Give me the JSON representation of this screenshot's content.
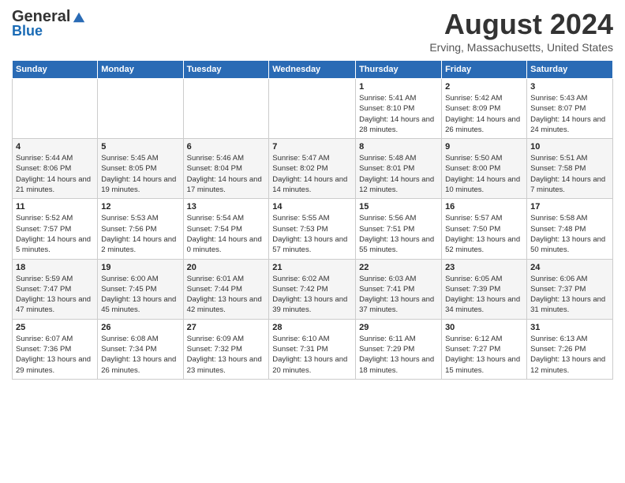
{
  "header": {
    "logo_general": "General",
    "logo_blue": "Blue",
    "month": "August 2024",
    "location": "Erving, Massachusetts, United States"
  },
  "days_of_week": [
    "Sunday",
    "Monday",
    "Tuesday",
    "Wednesday",
    "Thursday",
    "Friday",
    "Saturday"
  ],
  "weeks": [
    [
      {
        "day": "",
        "info": ""
      },
      {
        "day": "",
        "info": ""
      },
      {
        "day": "",
        "info": ""
      },
      {
        "day": "",
        "info": ""
      },
      {
        "day": "1",
        "info": "Sunrise: 5:41 AM\nSunset: 8:10 PM\nDaylight: 14 hours and 28 minutes."
      },
      {
        "day": "2",
        "info": "Sunrise: 5:42 AM\nSunset: 8:09 PM\nDaylight: 14 hours and 26 minutes."
      },
      {
        "day": "3",
        "info": "Sunrise: 5:43 AM\nSunset: 8:07 PM\nDaylight: 14 hours and 24 minutes."
      }
    ],
    [
      {
        "day": "4",
        "info": "Sunrise: 5:44 AM\nSunset: 8:06 PM\nDaylight: 14 hours and 21 minutes."
      },
      {
        "day": "5",
        "info": "Sunrise: 5:45 AM\nSunset: 8:05 PM\nDaylight: 14 hours and 19 minutes."
      },
      {
        "day": "6",
        "info": "Sunrise: 5:46 AM\nSunset: 8:04 PM\nDaylight: 14 hours and 17 minutes."
      },
      {
        "day": "7",
        "info": "Sunrise: 5:47 AM\nSunset: 8:02 PM\nDaylight: 14 hours and 14 minutes."
      },
      {
        "day": "8",
        "info": "Sunrise: 5:48 AM\nSunset: 8:01 PM\nDaylight: 14 hours and 12 minutes."
      },
      {
        "day": "9",
        "info": "Sunrise: 5:50 AM\nSunset: 8:00 PM\nDaylight: 14 hours and 10 minutes."
      },
      {
        "day": "10",
        "info": "Sunrise: 5:51 AM\nSunset: 7:58 PM\nDaylight: 14 hours and 7 minutes."
      }
    ],
    [
      {
        "day": "11",
        "info": "Sunrise: 5:52 AM\nSunset: 7:57 PM\nDaylight: 14 hours and 5 minutes."
      },
      {
        "day": "12",
        "info": "Sunrise: 5:53 AM\nSunset: 7:56 PM\nDaylight: 14 hours and 2 minutes."
      },
      {
        "day": "13",
        "info": "Sunrise: 5:54 AM\nSunset: 7:54 PM\nDaylight: 14 hours and 0 minutes."
      },
      {
        "day": "14",
        "info": "Sunrise: 5:55 AM\nSunset: 7:53 PM\nDaylight: 13 hours and 57 minutes."
      },
      {
        "day": "15",
        "info": "Sunrise: 5:56 AM\nSunset: 7:51 PM\nDaylight: 13 hours and 55 minutes."
      },
      {
        "day": "16",
        "info": "Sunrise: 5:57 AM\nSunset: 7:50 PM\nDaylight: 13 hours and 52 minutes."
      },
      {
        "day": "17",
        "info": "Sunrise: 5:58 AM\nSunset: 7:48 PM\nDaylight: 13 hours and 50 minutes."
      }
    ],
    [
      {
        "day": "18",
        "info": "Sunrise: 5:59 AM\nSunset: 7:47 PM\nDaylight: 13 hours and 47 minutes."
      },
      {
        "day": "19",
        "info": "Sunrise: 6:00 AM\nSunset: 7:45 PM\nDaylight: 13 hours and 45 minutes."
      },
      {
        "day": "20",
        "info": "Sunrise: 6:01 AM\nSunset: 7:44 PM\nDaylight: 13 hours and 42 minutes."
      },
      {
        "day": "21",
        "info": "Sunrise: 6:02 AM\nSunset: 7:42 PM\nDaylight: 13 hours and 39 minutes."
      },
      {
        "day": "22",
        "info": "Sunrise: 6:03 AM\nSunset: 7:41 PM\nDaylight: 13 hours and 37 minutes."
      },
      {
        "day": "23",
        "info": "Sunrise: 6:05 AM\nSunset: 7:39 PM\nDaylight: 13 hours and 34 minutes."
      },
      {
        "day": "24",
        "info": "Sunrise: 6:06 AM\nSunset: 7:37 PM\nDaylight: 13 hours and 31 minutes."
      }
    ],
    [
      {
        "day": "25",
        "info": "Sunrise: 6:07 AM\nSunset: 7:36 PM\nDaylight: 13 hours and 29 minutes."
      },
      {
        "day": "26",
        "info": "Sunrise: 6:08 AM\nSunset: 7:34 PM\nDaylight: 13 hours and 26 minutes."
      },
      {
        "day": "27",
        "info": "Sunrise: 6:09 AM\nSunset: 7:32 PM\nDaylight: 13 hours and 23 minutes."
      },
      {
        "day": "28",
        "info": "Sunrise: 6:10 AM\nSunset: 7:31 PM\nDaylight: 13 hours and 20 minutes."
      },
      {
        "day": "29",
        "info": "Sunrise: 6:11 AM\nSunset: 7:29 PM\nDaylight: 13 hours and 18 minutes."
      },
      {
        "day": "30",
        "info": "Sunrise: 6:12 AM\nSunset: 7:27 PM\nDaylight: 13 hours and 15 minutes."
      },
      {
        "day": "31",
        "info": "Sunrise: 6:13 AM\nSunset: 7:26 PM\nDaylight: 13 hours and 12 minutes."
      }
    ]
  ]
}
